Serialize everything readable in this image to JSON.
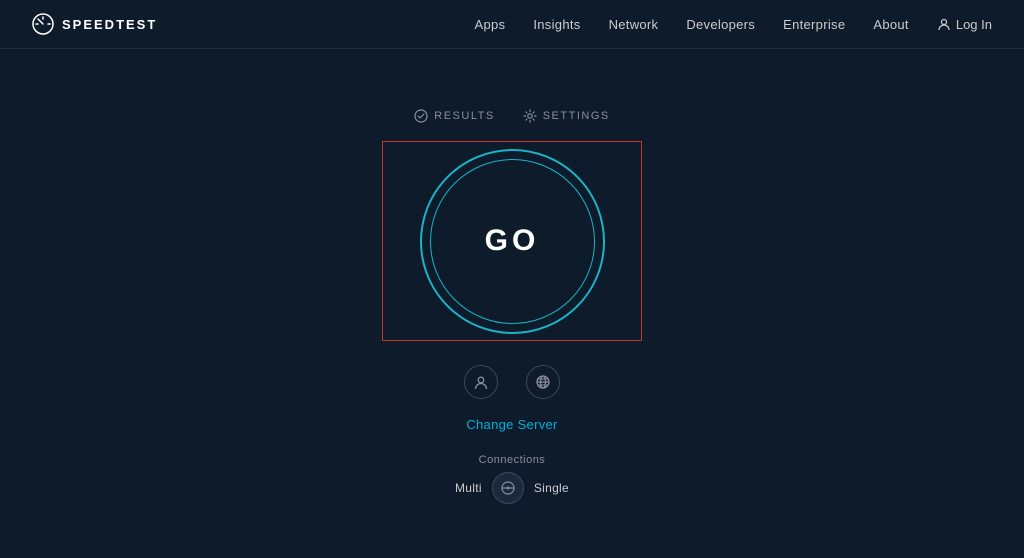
{
  "brand": {
    "name": "SPEEDTEST",
    "logo_alt": "speedtest logo"
  },
  "navbar": {
    "links": [
      {
        "label": "Apps",
        "id": "apps"
      },
      {
        "label": "Insights",
        "id": "insights"
      },
      {
        "label": "Network",
        "id": "network"
      },
      {
        "label": "Developers",
        "id": "developers"
      },
      {
        "label": "Enterprise",
        "id": "enterprise"
      },
      {
        "label": "About",
        "id": "about"
      }
    ],
    "login_label": "Log In"
  },
  "tabs": [
    {
      "label": "RESULTS",
      "icon": "check-circle-icon"
    },
    {
      "label": "SETTINGS",
      "icon": "gear-icon"
    }
  ],
  "go_button": {
    "label": "GO"
  },
  "icons": [
    {
      "id": "person-icon",
      "title": "User"
    },
    {
      "id": "globe-icon",
      "title": "Server Location"
    }
  ],
  "change_server": {
    "label": "Change Server"
  },
  "connections": {
    "label": "Connections",
    "options": [
      "Multi",
      "Single"
    ],
    "toggle_icon": "toggle-icon"
  }
}
